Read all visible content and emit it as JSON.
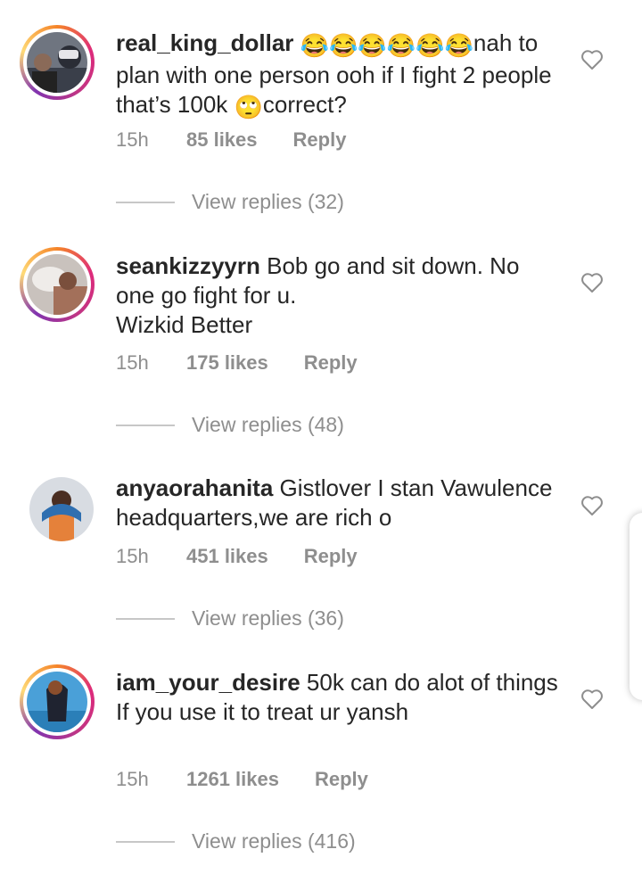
{
  "comments": [
    {
      "username": "real_king_dollar",
      "text_before": "",
      "emoji1": "😂😂😂😂😂😂",
      "text_mid": "nah to plan with one person ooh  if I fight 2 people that’s 100k ",
      "emoji2": "🙄",
      "text_after": "correct?",
      "time": "15h",
      "likes": "85 likes",
      "reply": "Reply",
      "view_replies": "View replies (32)"
    },
    {
      "username": "seankizzyyrn",
      "text": "Bob go and sit down. No one go fight for u.",
      "text_line2": "Wizkid Better",
      "time": "15h",
      "likes": "175 likes",
      "reply": "Reply",
      "view_replies": "View replies (48)"
    },
    {
      "username": "anyaorahanita",
      "text": "Gistlover I stan Vawulence headquarters,we are rich o",
      "time": "15h",
      "likes": "451 likes",
      "reply": "Reply",
      "view_replies": "View replies (36)"
    },
    {
      "username": "iam_your_desire",
      "text": "50k can do alot of things",
      "text_line2": "If you use it to treat ur yansh",
      "time": "15h",
      "likes": "1261 likes",
      "reply": "Reply",
      "view_replies": "View replies (416)"
    }
  ],
  "icons": {
    "like": "heart-outline-icon"
  },
  "colors": {
    "text": "#262626",
    "muted": "#8e8e8e",
    "divider": "#c7c7c7"
  }
}
